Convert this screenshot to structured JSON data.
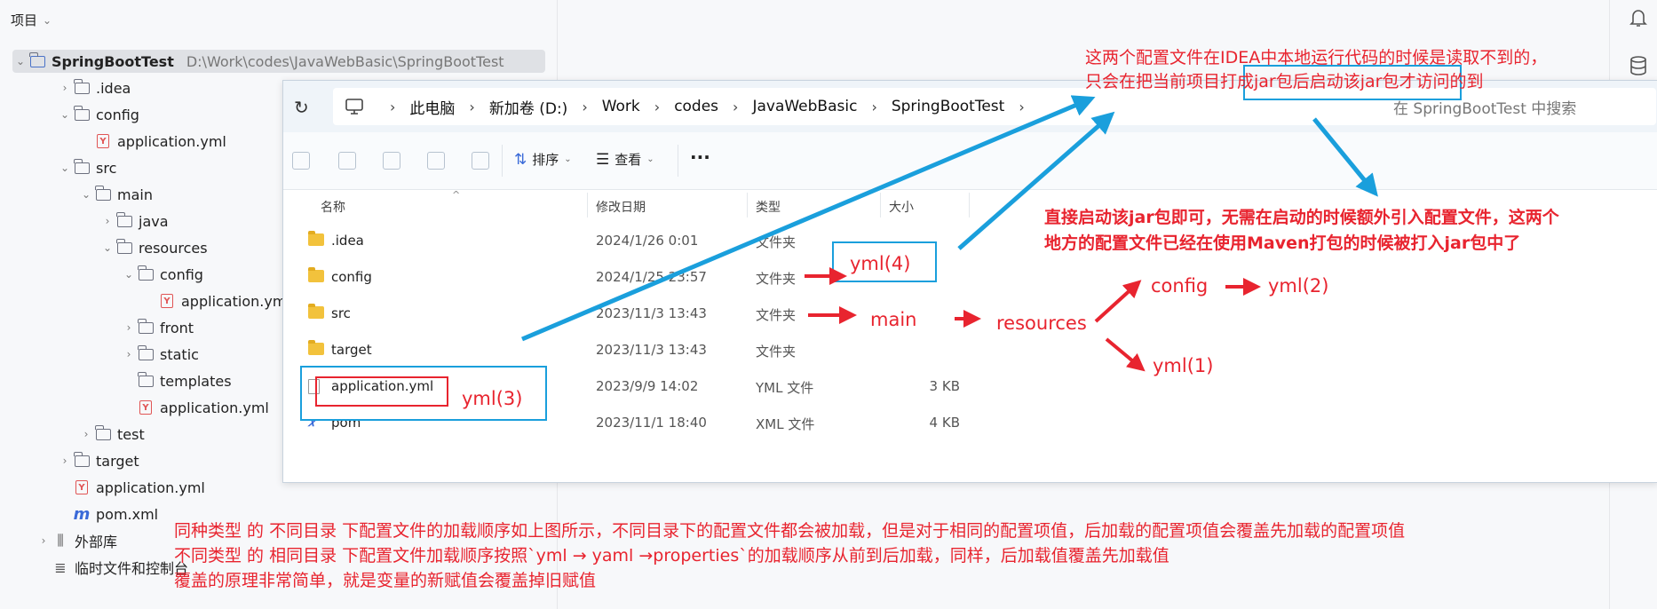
{
  "panel": {
    "title": "项目",
    "tree": [
      {
        "label": "SpringBootTest",
        "path": "D:\\Work\\codes\\JavaWebBasic\\SpringBootTest",
        "icon": "module-folder-icon",
        "chev": "⌄"
      },
      {
        "label": ".idea",
        "icon": "folder-icon",
        "chev": "›"
      },
      {
        "label": "config",
        "icon": "folder-icon",
        "chev": "⌄"
      },
      {
        "label": "application.yml",
        "icon": "yml-file-icon",
        "chev": ""
      },
      {
        "label": "src",
        "icon": "folder-icon",
        "chev": "⌄"
      },
      {
        "label": "main",
        "icon": "folder-icon",
        "chev": "⌄"
      },
      {
        "label": "java",
        "icon": "folder-icon",
        "chev": "›"
      },
      {
        "label": "resources",
        "icon": "folder-icon",
        "chev": "⌄"
      },
      {
        "label": "config",
        "icon": "folder-icon",
        "chev": "⌄"
      },
      {
        "label": "application.yml",
        "icon": "yml-file-icon",
        "chev": ""
      },
      {
        "label": "front",
        "icon": "folder-icon",
        "chev": "›"
      },
      {
        "label": "static",
        "icon": "folder-icon",
        "chev": "›"
      },
      {
        "label": "templates",
        "icon": "folder-icon",
        "chev": ""
      },
      {
        "label": "application.yml",
        "icon": "yml-file-icon",
        "chev": ""
      },
      {
        "label": "test",
        "icon": "folder-icon",
        "chev": "›"
      },
      {
        "label": "target",
        "icon": "folder-icon",
        "chev": "›"
      },
      {
        "label": "application.yml",
        "icon": "yml-file-icon",
        "chev": ""
      },
      {
        "label": "pom.xml",
        "icon": "maven-icon",
        "chev": ""
      },
      {
        "label": "外部库",
        "icon": "library-icon",
        "chev": "›"
      },
      {
        "label": "临时文件和控制台",
        "icon": "scratch-icon",
        "chev": ""
      }
    ]
  },
  "explorer": {
    "breadcrumb": [
      "此电脑",
      "新加卷 (D:)",
      "Work",
      "codes",
      "JavaWebBasic",
      "SpringBootTest"
    ],
    "search_placeholder": "在 SpringBootTest 中搜索",
    "toolbar": {
      "sort_label": "排序",
      "view_label": "查看",
      "more_label": "···"
    },
    "columns": {
      "name": "名称",
      "date": "修改日期",
      "type": "类型",
      "size": "大小"
    },
    "files": [
      {
        "name": ".idea",
        "date": "2024/1/26 0:01",
        "type": "文件夹",
        "size": "",
        "icon": "folder"
      },
      {
        "name": "config",
        "date": "2024/1/25 23:57",
        "type": "文件夹",
        "size": "",
        "icon": "folder"
      },
      {
        "name": "src",
        "date": "2023/11/3 13:43",
        "type": "文件夹",
        "size": "",
        "icon": "folder"
      },
      {
        "name": "target",
        "date": "2023/11/3 13:43",
        "type": "文件夹",
        "size": "",
        "icon": "folder"
      },
      {
        "name": "application.yml",
        "date": "2023/9/9 14:02",
        "type": "YML 文件",
        "size": "3 KB",
        "icon": "doc"
      },
      {
        "name": "pom",
        "date": "2023/11/1 18:40",
        "type": "XML 文件",
        "size": "4 KB",
        "icon": "xml"
      }
    ]
  },
  "annotations": {
    "top_note_1": "这两个配置文件在IDEA中本地运行代码的时候是读取不到的，",
    "top_note_2": "只会在把当前项目打成jar包后启动该jar包才访问的到",
    "bold_note_1": "直接启动该jar包即可，无需在启动的时候额外引入配置文件，这两个",
    "bold_note_2": "地方的配置文件已经在使用Maven打包的时候被打入jar包中了",
    "yml4": "yml(4)",
    "yml3": "yml(3)",
    "yml2": "yml(2)",
    "yml1": "yml(1)",
    "main": "main",
    "resources": "resources",
    "config": "config",
    "bottom_1": "同种类型 的 不同目录 下配置文件的加载顺序如上图所示，不同目录下的配置文件都会被加载，但是对于相同的配置项值，后加载的配置项值会覆盖先加载的配置项值",
    "bottom_2": "不同类型 的 相同目录 下配置文件加载顺序按照`yml → yaml →properties`的加载顺序从前到后加载，同样，后加载值覆盖先加载值",
    "bottom_3": "覆盖的原理非常简单，就是变量的新赋值会覆盖掉旧赋值"
  },
  "colors": {
    "annotation_red": "#e8242f",
    "annotation_blue": "#1a9fdc",
    "folder_yellow": "#f2c23c"
  }
}
